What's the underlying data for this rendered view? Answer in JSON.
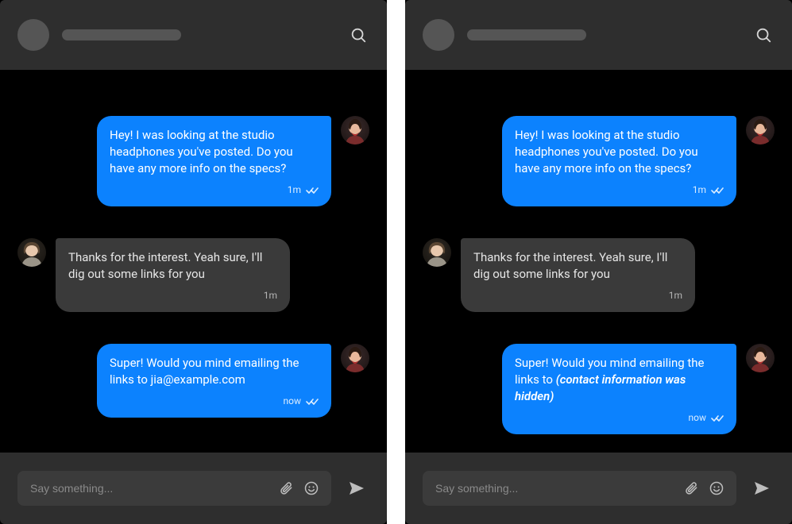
{
  "composer": {
    "placeholder": "Say something..."
  },
  "icons": {
    "search": "search-icon",
    "attach": "paperclip-icon",
    "emoji": "smile-icon",
    "send": "send-icon",
    "read": "double-check-icon"
  },
  "panes": [
    {
      "messages": [
        {
          "direction": "out",
          "text": "Hey! I was looking at the studio headphones you've posted. Do you have any more info on the specs?",
          "time": "1m",
          "read": true,
          "avatar": "user-a"
        },
        {
          "direction": "in",
          "text": "Thanks for the interest. Yeah sure, I'll dig out some links for you",
          "time": "1m",
          "read": false,
          "avatar": "user-b"
        },
        {
          "direction": "out",
          "text": "Super! Would you mind emailing the links to jia@example.com",
          "time": "now",
          "read": true,
          "avatar": "user-a"
        }
      ]
    },
    {
      "messages": [
        {
          "direction": "out",
          "text": "Hey! I was looking at the studio headphones you've posted. Do you have any more info on the specs?",
          "time": "1m",
          "read": true,
          "avatar": "user-a"
        },
        {
          "direction": "in",
          "text": "Thanks for the interest. Yeah sure, I'll dig out some links for you",
          "time": "1m",
          "read": false,
          "avatar": "user-b"
        },
        {
          "direction": "out",
          "text": "Super! Would you mind emailing the links to ",
          "redacted": "(contact information was hidden)",
          "time": "now",
          "read": true,
          "avatar": "user-a"
        }
      ]
    }
  ]
}
